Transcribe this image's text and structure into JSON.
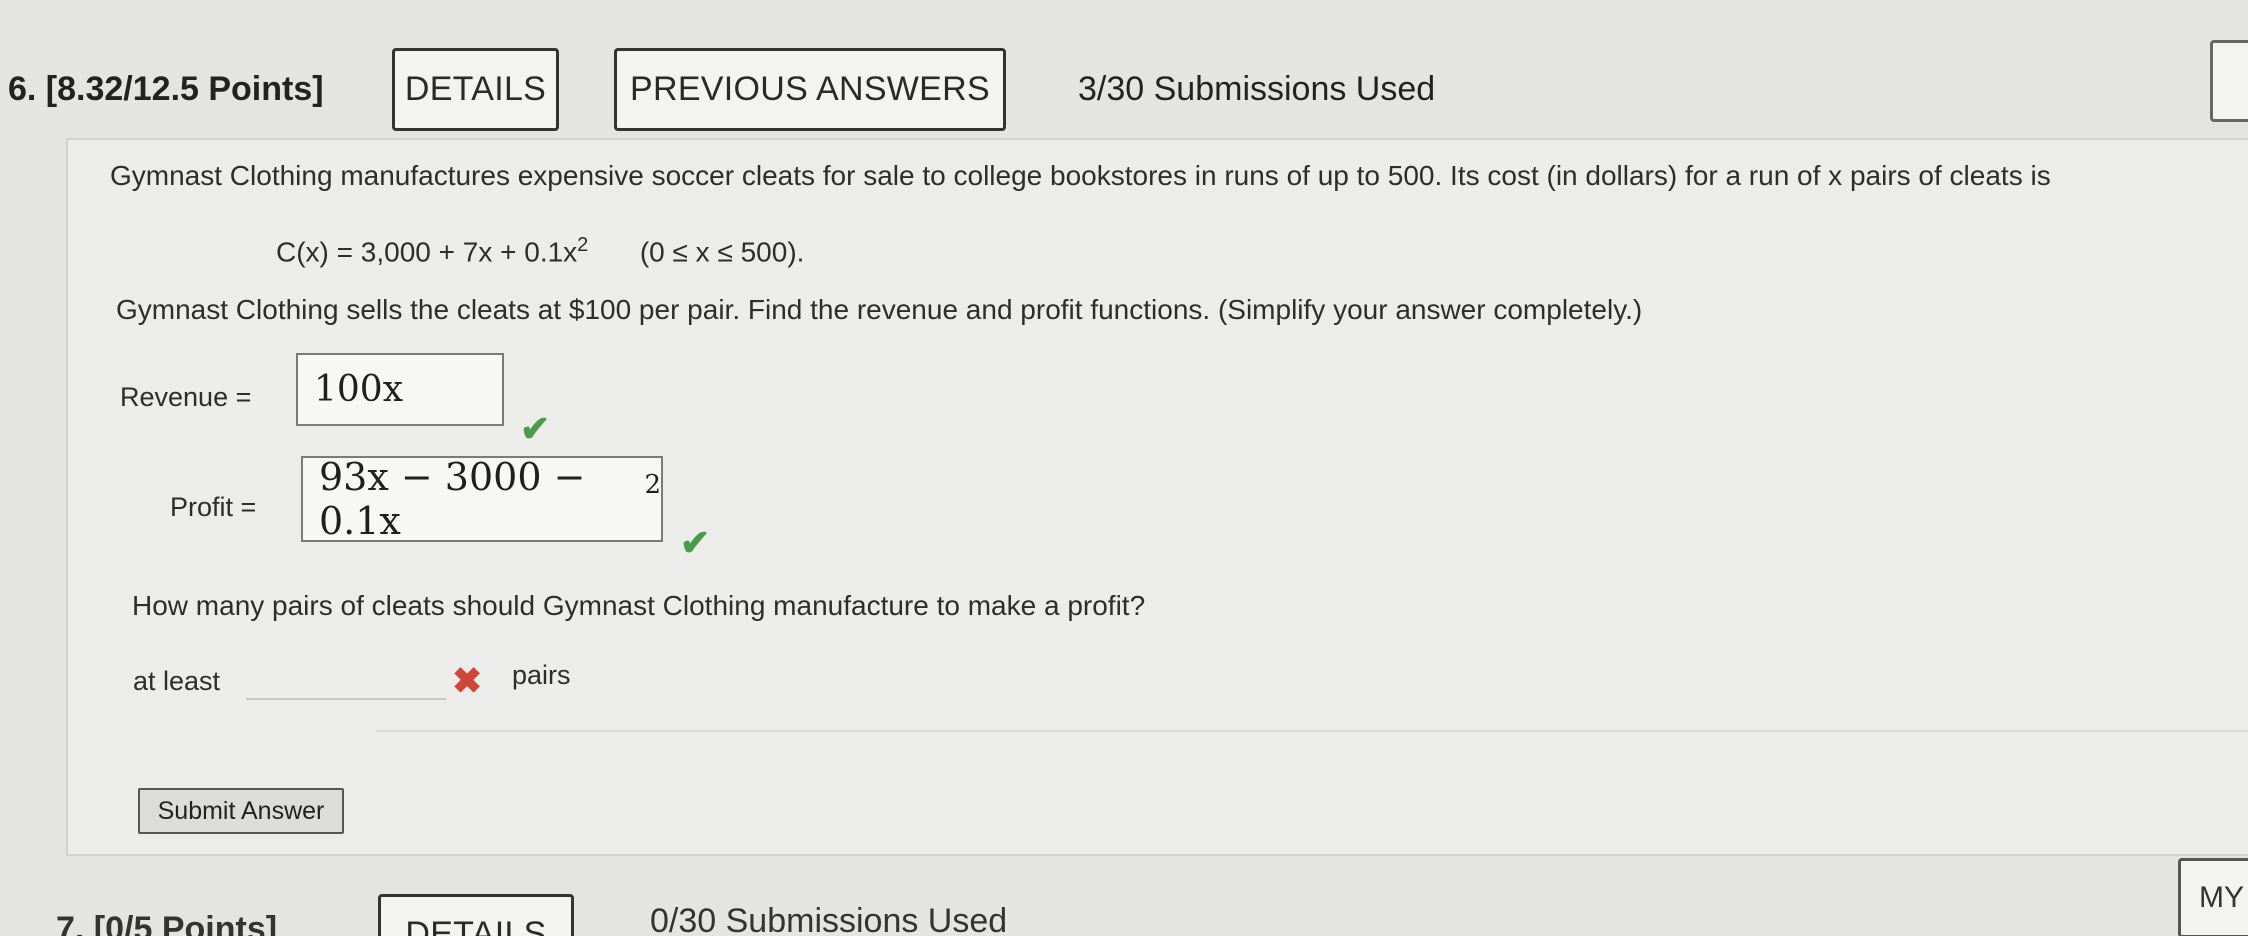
{
  "header": {
    "question_title": "6. [8.32/12.5 Points]",
    "details_label": "DETAILS",
    "previous_answers_label": "PREVIOUS ANSWERS",
    "submissions": "3/30 Submissions Used"
  },
  "question": {
    "stem": "Gymnast Clothing manufactures expensive soccer cleats for sale to college bookstores in runs of up to 500. Its cost (in dollars) for a run of x pairs of cleats is",
    "cost_lhs": "C(x) = 3,000 + 7x + 0.1x",
    "cost_exp": "2",
    "cost_domain": "(0 ≤ x ≤ 500).",
    "sells_text": "Gymnast Clothing sells the cleats at $100 per pair. Find the revenue and profit functions. (Simplify your answer completely.)",
    "revenue_label": "Revenue =",
    "revenue_value": "100x",
    "profit_label": "Profit =",
    "profit_value": "93x − 3000 − 0.1x",
    "profit_exp": "2",
    "correct_mark": "✔",
    "how_many_text": "How many pairs of cleats should Gymnast Clothing manufacture to make a profit?",
    "at_least_label": "at least",
    "at_least_value": "",
    "incorrect_mark": "✖",
    "pairs_label": "pairs",
    "submit_label": "Submit Answer"
  },
  "next_question": {
    "points_partial": "7. [0/5 Points]",
    "details_label": "DETAILS",
    "submissions": "0/30 Submissions Used",
    "my_button_label": "MY"
  },
  "colors": {
    "correct": "#4a9b4a",
    "incorrect": "#d0463a"
  }
}
